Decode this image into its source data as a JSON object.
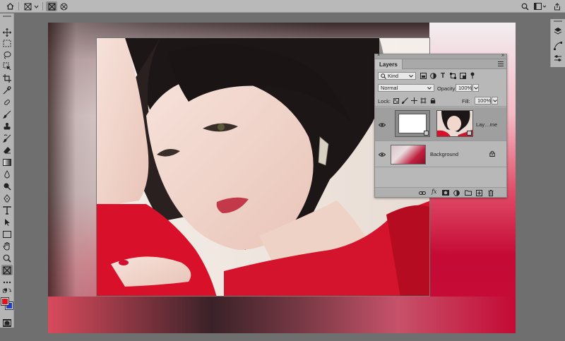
{
  "options_bar": {
    "icons": [
      "home-icon",
      "frame-tool-icon",
      "chevron-down-icon",
      "rectangle-frame-icon",
      "ellipse-frame-icon",
      "search-icon",
      "workspace-icon",
      "share-icon"
    ]
  },
  "toolbar": {
    "tools": [
      "move-tool",
      "marquee-tool",
      "lasso-tool",
      "object-selection-tool",
      "crop-tool",
      "eyedropper-tool",
      "spot-healing-tool",
      "brush-tool",
      "clone-stamp-tool",
      "history-brush-tool",
      "eraser-tool",
      "gradient-tool",
      "blur-tool",
      "dodge-tool",
      "pen-tool",
      "type-tool",
      "path-selection-tool",
      "rectangle-tool",
      "hand-tool",
      "zoom-tool",
      "frame-tool",
      "edit-toolbar",
      "default-colors",
      "foreground-background-colors",
      "quick-mask",
      "screen-mode"
    ],
    "active_tool": "frame-tool",
    "foreground_color": "#e8101a",
    "background_color": "#1a3cd8"
  },
  "layers_panel": {
    "tab_label": "Layers",
    "filter_kind": "Kind",
    "blend_mode": "Normal",
    "opacity_label": "Opacity:",
    "opacity_value": "100%",
    "lock_label": "Lock:",
    "fill_label": "Fill:",
    "fill_value": "100%",
    "layers": [
      {
        "name": "Lay…me",
        "selected": true
      },
      {
        "name": "Background",
        "selected": false,
        "locked": true
      }
    ],
    "bottom_icons": [
      "link-icon",
      "fx-icon",
      "mask-icon",
      "adjustment-icon",
      "folder-icon",
      "new-layer-icon",
      "trash-icon"
    ],
    "fx_label": "fx"
  }
}
